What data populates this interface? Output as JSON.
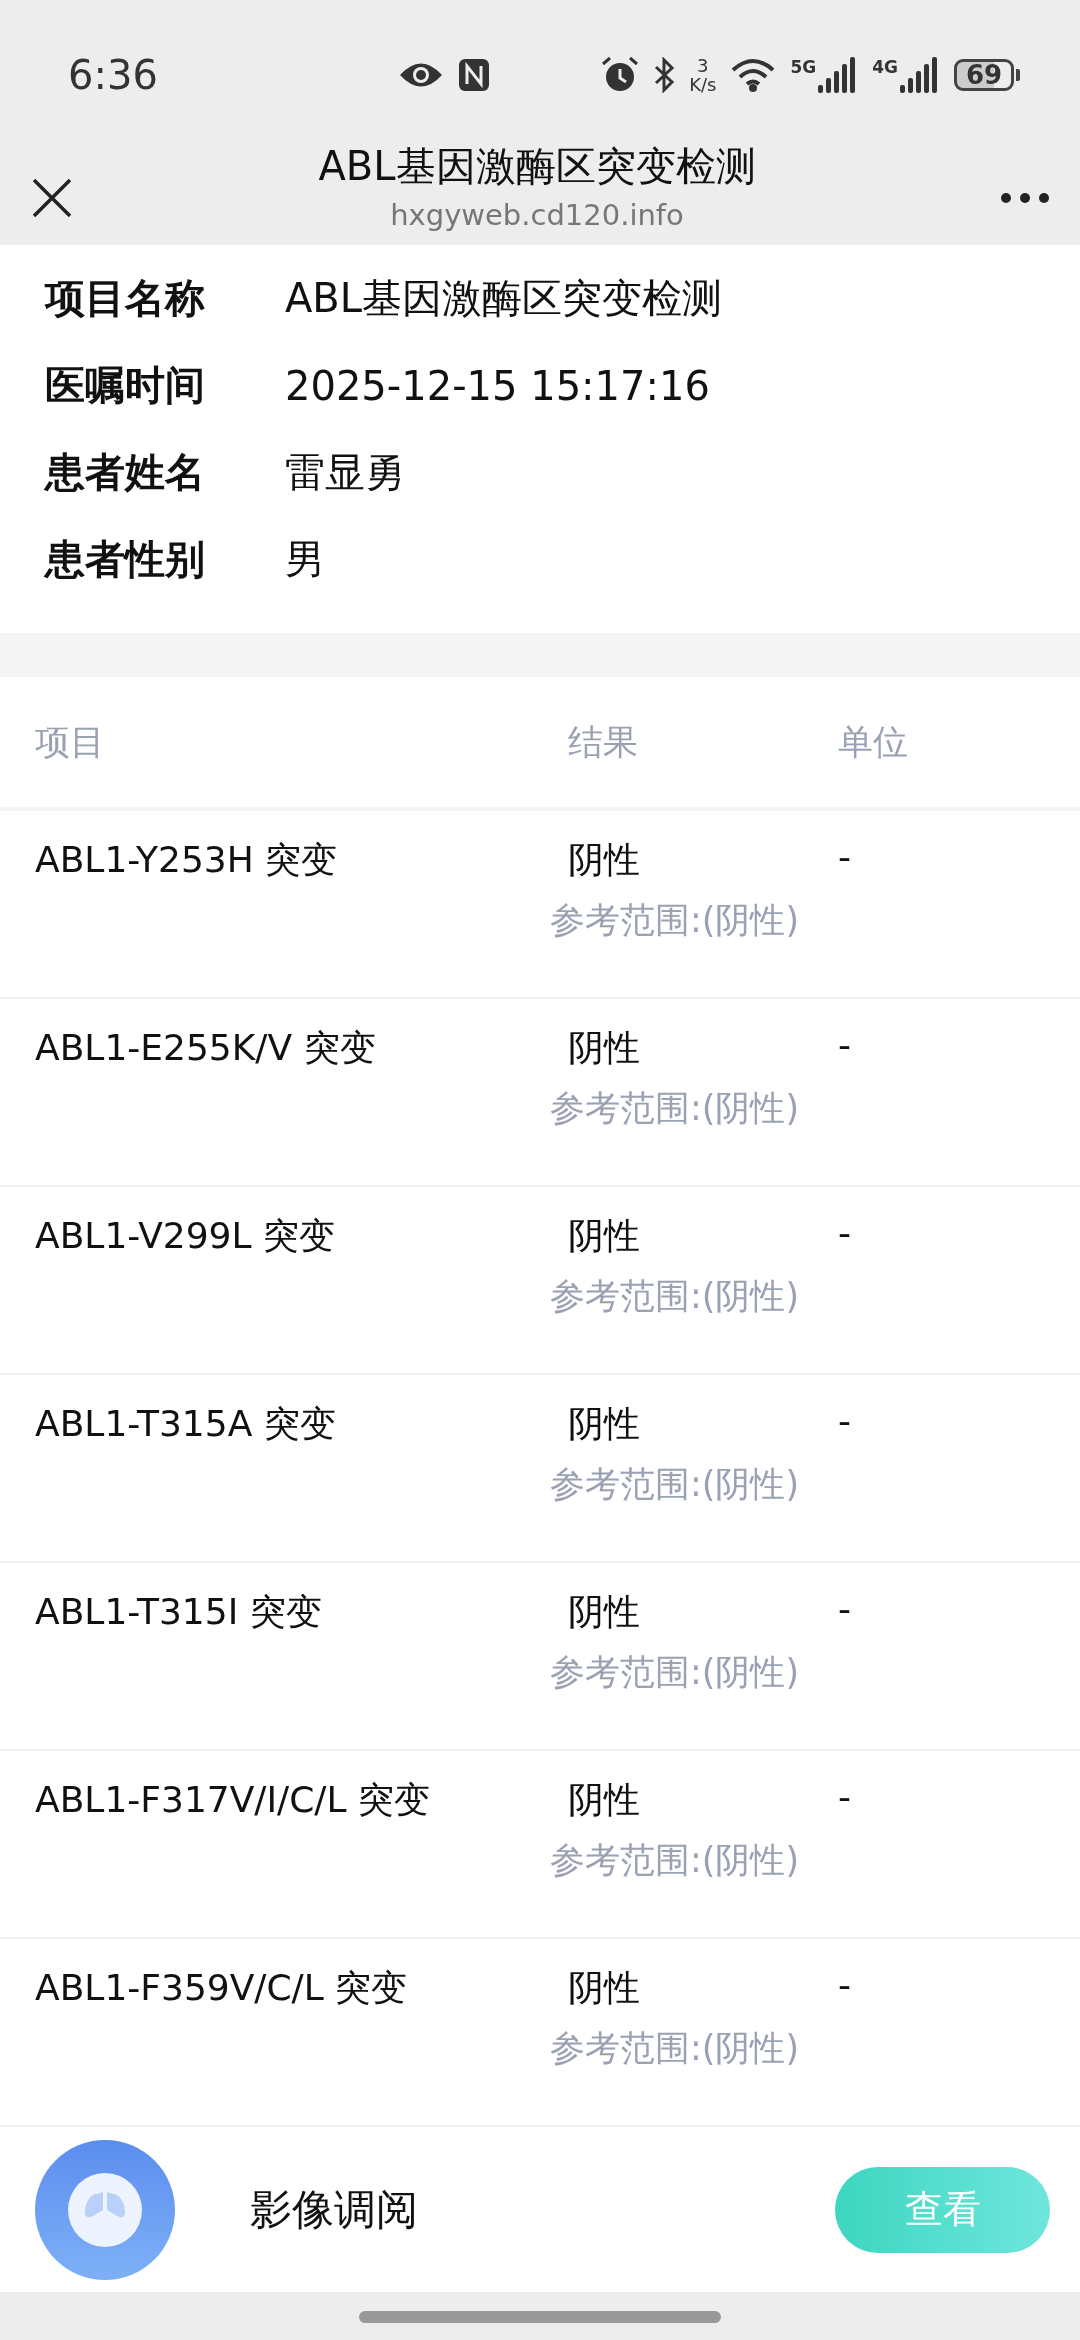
{
  "status_bar": {
    "time": "6:36",
    "speed_value": "3",
    "speed_unit": "K/s",
    "signal_1_label": "5G",
    "signal_2_label": "4G",
    "battery": "69"
  },
  "header": {
    "title": "ABL基因激酶区突变检测",
    "url": "hxgyweb.cd120.info"
  },
  "info": [
    {
      "label": "项目名称",
      "value": "ABL基因激酶区突变检测"
    },
    {
      "label": "医嘱时间",
      "value": "2025-12-15 15:17:16"
    },
    {
      "label": "患者姓名",
      "value": "雷显勇"
    },
    {
      "label": "患者性别",
      "value": "男"
    }
  ],
  "table": {
    "columns": [
      "项目",
      "结果",
      "单位"
    ],
    "rows": [
      {
        "item": "ABL1-Y253H 突变",
        "result": "阴性",
        "unit": "-",
        "reference": "参考范围:(阴性)"
      },
      {
        "item": "ABL1-E255K/V 突变",
        "result": "阴性",
        "unit": "-",
        "reference": "参考范围:(阴性)"
      },
      {
        "item": "ABL1-V299L 突变",
        "result": "阴性",
        "unit": "-",
        "reference": "参考范围:(阴性)"
      },
      {
        "item": "ABL1-T315A 突变",
        "result": "阴性",
        "unit": "-",
        "reference": "参考范围:(阴性)"
      },
      {
        "item": "ABL1-T315I 突变",
        "result": "阴性",
        "unit": "-",
        "reference": "参考范围:(阴性)"
      },
      {
        "item": "ABL1-F317V/I/C/L 突变",
        "result": "阴性",
        "unit": "-",
        "reference": "参考范围:(阴性)"
      },
      {
        "item": "ABL1-F359V/C/L 突变",
        "result": "阴性",
        "unit": "-",
        "reference": "参考范围:(阴性)"
      }
    ]
  },
  "image_card": {
    "title": "影像调阅",
    "button": "查看"
  }
}
